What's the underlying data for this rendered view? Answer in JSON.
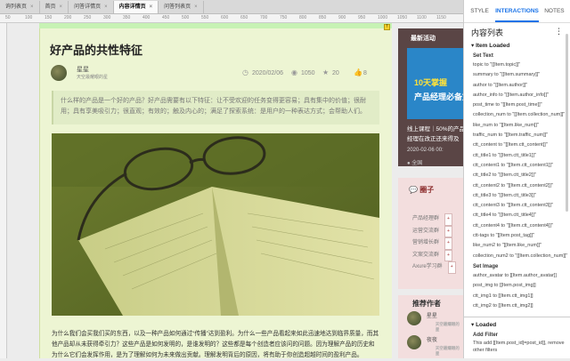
{
  "tabs": [
    {
      "label": "询列表页",
      "active": false
    },
    {
      "label": "首页",
      "active": false
    },
    {
      "label": "问答详情页",
      "active": false
    },
    {
      "label": "内容详情页",
      "active": true
    },
    {
      "label": "问答列表页",
      "active": false
    }
  ],
  "ruler_marks": [
    "50",
    "100",
    "150",
    "200",
    "250",
    "300",
    "350",
    "400",
    "450",
    "500",
    "550",
    "600",
    "650",
    "700",
    "750",
    "800",
    "850",
    "900",
    "950",
    "1000",
    "1050",
    "1100",
    "1150"
  ],
  "article": {
    "title": "好产品的共性特征",
    "author": "星星",
    "author_info": "天空最耀眼的星",
    "post_time": "2020/02/06",
    "traffic_num": "1050",
    "collection_num": "20",
    "like_num": "8",
    "summary": "什么样的产品是一个好的产品？好产品需要有以下特征：让不受欢迎的任务变得更容易；具有集中的价值；很耐用；具有享美吸引力；很直观；有效的；触及内心的；满足了探索系统：是用户的一种表达方式；会帮助人们。",
    "paragraph": "为什么我们会买我们买的东西，以及一种产品如何通过“传播”达到盈利。为什么一些产品看起来如此迅速地达到临界质量，而其他产品却从未获得牵引力？这些产品是如何发明的，是谁发明的？这些都是每个创造者应该问的问题。因为理解产品的历史和为什么它们会发挥作用，是为了理解如何为未来做出贡献。理解发明背后的原因，将有助于你创造超越时间的盈利产品。"
  },
  "sidebar": {
    "activity_title": "最新活动",
    "promo_line1": "10天掌握",
    "promo_line2": "产品经理必备文",
    "course_title": "线上课程｜50%的产品经理在改正还来得及",
    "course_date": "2020-02-06 00:",
    "course_location": "全国",
    "circle_title": "圈子",
    "circle_items": [
      "产品经理群",
      "运营交流群",
      "营销增长群",
      "文案交流群",
      "Axure学习群"
    ],
    "join_label": "+",
    "authors_title": "推荐作者",
    "authors": [
      {
        "name": "星星",
        "sub": "天空最耀眼的星"
      },
      {
        "name": "夜夜",
        "sub": "天空最耀眼的星"
      }
    ]
  },
  "panel": {
    "tabs": [
      "STYLE",
      "INTERACTIONS",
      "NOTES"
    ],
    "active_tab": "INTERACTIONS",
    "title": "内容列表",
    "more_icon": "more-icon",
    "event1": "Item Loaded",
    "set_text_label": "Set Text",
    "set_text_actions": [
      "topic to \"[[Item.topic]]\"",
      "summary to \"[[Item.summary]]\"",
      "author to \"[[Item.author]]\"",
      "author_info to \"[[Item.author_info]]\"",
      "post_time to \"[[Item.post_time]]\"",
      "collection_num to \"[[Item.collection_num]]\"",
      "like_num to \"[[Item.like_num]]\"",
      "traffic_num to \"[[Item.traffic_num]]\"",
      "ctt_content to \"[[Item.ctt_content]]\"",
      "ctt_title1 to \"[[Item.ctt_title1]]\"",
      "ctt_content1 to \"[[Item.ctt_content1]]\"",
      "ctt_title2 to \"[[Item.ctt_title2]]\"",
      "ctt_content2 to \"[[Item.ctt_content2]]\"",
      "ctt_title3 to \"[[Item.ctt_title3]]\"",
      "ctt_content3 to \"[[Item.ctt_content3]]\"",
      "ctt_title4 to \"[[Item.ctt_title4]]\"",
      "ctt_content4 to \"[[Item.ctt_content4]]\"",
      "ctt-tags to \"[[Item.post_tag]]\"",
      "like_num2 to \"[[Item.like_num]]\"",
      "collection_num2 to \"[[Item.collection_num]]\""
    ],
    "set_image_label": "Set Image",
    "set_image_actions": [
      "author_avatar to [[Item.author_avatar]]",
      "post_img to [[Item.post_img]]",
      "ctt_img1 to [[Item.ctt_img1]]",
      "ctt_img2 to [[Item.ctt_img2]]"
    ],
    "event2": "Loaded",
    "add_filter_label": "Add Filter",
    "add_filter_action": "This add [[Item.post_id]=post_id]], remove other filters"
  },
  "colors": {
    "accent": "#1a73e8",
    "page_bg": "#edf5d3",
    "green_bar": "#c7f2b4"
  }
}
